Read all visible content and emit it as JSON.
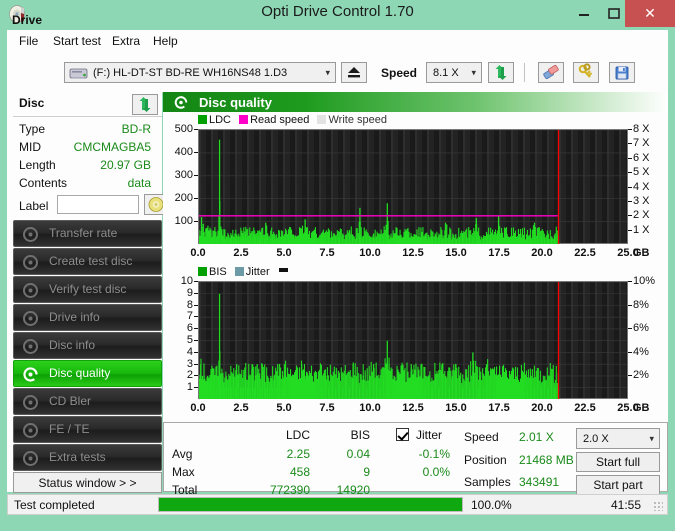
{
  "window": {
    "title": "Opti Drive Control 1.70",
    "icon": "disc-icon",
    "minimize": "–",
    "maximize": "☐",
    "close": "✕"
  },
  "menu": {
    "items": [
      {
        "label": "File"
      },
      {
        "label": "Start test"
      },
      {
        "label": "Extra"
      },
      {
        "label": "Help"
      }
    ]
  },
  "toolbar": {
    "drive_label": "Drive",
    "drive_value": "(F:)  HL-DT-ST BD-RE  WH16NS48 1.D3",
    "eject_icon": "eject-icon",
    "speed_label": "Speed",
    "speed_value": "8.1 X",
    "refresh_icon": "refresh-icon",
    "eraser_icon": "eraser-icon",
    "keys_icon": "keys-icon",
    "save_icon": "save-icon"
  },
  "disc_panel": {
    "header": "Disc",
    "refresh_icon": "refresh-icon",
    "rows": [
      {
        "key": "Type",
        "value": "BD-R"
      },
      {
        "key": "MID",
        "value": "CMCMAGBA5"
      },
      {
        "key": "Length",
        "value": "20.97 GB"
      },
      {
        "key": "Contents",
        "value": "data"
      }
    ],
    "label_key": "Label",
    "label_value": "",
    "label_placeholder": "",
    "label_button_icon": "disc-label-icon"
  },
  "nav": {
    "items": [
      {
        "label": "Transfer rate",
        "icon": "disc-test-icon",
        "selected": false
      },
      {
        "label": "Create test disc",
        "icon": "disc-write-icon",
        "selected": false
      },
      {
        "label": "Verify test disc",
        "icon": "disc-verify-icon",
        "selected": false
      },
      {
        "label": "Drive info",
        "icon": "drive-info-icon",
        "selected": false
      },
      {
        "label": "Disc info",
        "icon": "disc-info-icon",
        "selected": false
      },
      {
        "label": "Disc quality",
        "icon": "disc-quality-icon",
        "selected": true
      },
      {
        "label": "CD Bler",
        "icon": "disc-bler-icon",
        "selected": false
      },
      {
        "label": "FE / TE",
        "icon": "disc-fete-icon",
        "selected": false
      },
      {
        "label": "Extra tests",
        "icon": "disc-extra-icon",
        "selected": false
      }
    ],
    "status_window": "Status window > >"
  },
  "main": {
    "title": "Disc quality",
    "title_icon": "disc-quality-icon"
  },
  "chart_data": [
    {
      "type": "line",
      "name": "ldc-chart",
      "title": "",
      "xlabel": "GB",
      "ylabel": "",
      "xlim": [
        0,
        25
      ],
      "ylim": [
        0,
        500
      ],
      "y2lim": [
        0,
        8
      ],
      "y2label": "X",
      "xticks": [
        "0.0",
        "2.5",
        "5.0",
        "7.5",
        "10.0",
        "12.5",
        "15.0",
        "17.5",
        "20.0",
        "22.5",
        "25.0"
      ],
      "xtickvals": [
        0,
        2.5,
        5,
        7.5,
        10,
        12.5,
        15,
        17.5,
        20,
        22.5,
        25
      ],
      "yticks": [
        "100",
        "200",
        "300",
        "400",
        "500"
      ],
      "ytickvals": [
        100,
        200,
        300,
        400,
        500
      ],
      "y2ticks": [
        "1 X",
        "2 X",
        "3 X",
        "4 X",
        "5 X",
        "6 X",
        "7 X",
        "8 X"
      ],
      "y2tickvals": [
        1,
        2,
        3,
        4,
        5,
        6,
        7,
        8
      ],
      "legend": [
        {
          "label": "LDC",
          "color": "#00a000"
        },
        {
          "label": "Read speed",
          "color": "#ff00c8"
        },
        {
          "label": "Write speed",
          "color": "#e8e8e8"
        }
      ],
      "end_marker_x": 21.0,
      "end_marker_color": "#ff0000",
      "read_speed_line": 2.0,
      "data_end_x": 21.0,
      "series": [
        {
          "name": "LDC",
          "color": "#22dd22",
          "x": [
            0.05,
            0.15,
            0.25,
            0.3,
            0.4,
            0.45,
            0.5,
            0.6,
            0.7,
            0.8,
            0.9,
            1.0,
            1.1,
            1.2,
            1.3,
            1.35,
            1.4,
            1.5,
            1.6,
            1.7,
            1.8,
            1.9,
            2.0,
            2.1,
            2.2,
            2.3,
            2.4,
            2.5,
            2.6,
            2.7,
            2.8,
            2.9,
            3.0,
            3.1,
            3.2,
            3.3,
            3.4,
            3.5,
            3.6,
            3.7,
            3.8,
            3.9,
            4.0,
            4.1,
            4.2,
            4.3,
            4.4,
            4.5,
            4.6,
            4.7,
            4.8,
            4.9,
            5.0,
            5.2,
            5.4,
            5.6,
            5.8,
            6.0,
            6.2,
            6.4,
            6.6,
            6.7,
            6.8,
            7.0,
            7.2,
            7.4,
            7.6,
            7.8,
            8.0,
            8.2,
            8.4,
            8.6,
            8.8,
            9.0,
            9.2,
            9.4,
            9.45,
            9.6,
            9.8,
            10.0,
            10.2,
            10.4,
            10.6,
            10.8,
            11.0,
            11.1,
            11.2,
            11.4,
            11.6,
            11.8,
            12.0,
            12.2,
            12.4,
            12.6,
            12.8,
            13.0,
            13.2,
            13.4,
            13.6,
            13.8,
            14.0,
            14.2,
            14.4,
            14.6,
            14.8,
            15.0,
            15.2,
            15.4,
            15.6,
            15.8,
            16.0,
            16.2,
            16.3,
            16.4,
            16.6,
            16.8,
            17.0,
            17.2,
            17.4,
            17.5,
            17.6,
            17.8,
            18.0,
            18.2,
            18.4,
            18.6,
            18.8,
            19.0,
            19.2,
            19.4,
            19.6,
            19.8,
            20.0,
            20.2,
            20.4,
            20.6,
            20.8,
            21.0
          ],
          "y": [
            35,
            120,
            90,
            55,
            70,
            45,
            60,
            40,
            50,
            35,
            45,
            30,
            40,
            458,
            60,
            45,
            38,
            55,
            35,
            45,
            30,
            40,
            35,
            30,
            45,
            38,
            30,
            60,
            35,
            45,
            30,
            38,
            42,
            30,
            45,
            35,
            40,
            30,
            55,
            40,
            30,
            95,
            45,
            38,
            30,
            45,
            35,
            40,
            30,
            50,
            35,
            42,
            30,
            45,
            55,
            38,
            30,
            42,
            110,
            45,
            35,
            60,
            40,
            32,
            45,
            38,
            55,
            35,
            42,
            30,
            48,
            35,
            60,
            40,
            32,
            160,
            45,
            38,
            42,
            35,
            48,
            30,
            45,
            38,
            180,
            42,
            35,
            48,
            30,
            42,
            38,
            55,
            32,
            45,
            35,
            50,
            38,
            42,
            30,
            48,
            35,
            42,
            95,
            38,
            30,
            45,
            35,
            50,
            38,
            42,
            30,
            115,
            45,
            38,
            30,
            55,
            42,
            35,
            48,
            125,
            38,
            30,
            45,
            35,
            42,
            30,
            48,
            38,
            42,
            30,
            95,
            45,
            38,
            30,
            42,
            35,
            48,
            38,
            30,
            45
          ]
        }
      ]
    },
    {
      "type": "line",
      "name": "bis-chart",
      "title": "",
      "xlabel": "GB",
      "ylabel": "",
      "xlim": [
        0,
        25
      ],
      "ylim": [
        0,
        10
      ],
      "y2lim": [
        0,
        10
      ],
      "y2label": "%",
      "xticks": [
        "0.0",
        "2.5",
        "5.0",
        "7.5",
        "10.0",
        "12.5",
        "15.0",
        "17.5",
        "20.0",
        "22.5",
        "25.0"
      ],
      "xtickvals": [
        0,
        2.5,
        5,
        7.5,
        10,
        12.5,
        15,
        17.5,
        20,
        22.5,
        25
      ],
      "yticks": [
        "1",
        "2",
        "3",
        "4",
        "5",
        "6",
        "7",
        "8",
        "9",
        "10"
      ],
      "ytickvals": [
        1,
        2,
        3,
        4,
        5,
        6,
        7,
        8,
        9,
        10
      ],
      "y2ticks": [
        "2%",
        "4%",
        "6%",
        "8%",
        "10%"
      ],
      "y2tickvals": [
        2,
        4,
        6,
        8,
        10
      ],
      "legend": [
        {
          "label": "BIS",
          "color": "#00a000"
        },
        {
          "label": "Jitter",
          "color": "#6d9ba5"
        }
      ],
      "end_marker_x": 21.0,
      "end_marker_color": "#ff0000",
      "data_end_x": 21.0,
      "series": [
        {
          "name": "BIS",
          "color": "#22dd22",
          "x": [
            0.1,
            0.2,
            0.3,
            0.4,
            0.5,
            0.6,
            0.7,
            0.8,
            0.9,
            1.0,
            1.1,
            1.2,
            1.25,
            1.3,
            1.4,
            1.5,
            1.6,
            1.7,
            1.8,
            1.9,
            2.0,
            2.1,
            2.2,
            2.3,
            2.4,
            2.5,
            2.6,
            2.7,
            2.8,
            2.9,
            3.0,
            3.1,
            3.2,
            3.3,
            3.4,
            3.5,
            3.6,
            3.7,
            3.8,
            3.9,
            4.0,
            4.1,
            4.2,
            4.3,
            4.4,
            4.5,
            4.6,
            4.7,
            4.8,
            4.9,
            5.0,
            5.2,
            5.4,
            5.6,
            5.8,
            6.0,
            6.2,
            6.4,
            6.6,
            6.8,
            7.0,
            7.2,
            7.4,
            7.6,
            7.8,
            8.0,
            8.2,
            8.4,
            8.6,
            8.8,
            9.0,
            9.2,
            9.4,
            9.6,
            9.8,
            10.0,
            10.2,
            10.4,
            10.6,
            10.8,
            11.0,
            11.1,
            11.2,
            11.3,
            11.4,
            11.6,
            11.8,
            12.0,
            12.2,
            12.4,
            12.6,
            12.8,
            13.0,
            13.2,
            13.4,
            13.6,
            13.8,
            14.0,
            14.2,
            14.4,
            14.6,
            14.8,
            15.0,
            15.2,
            15.4,
            15.6,
            15.8,
            16.0,
            16.2,
            16.3,
            16.4,
            16.6,
            16.8,
            17.0,
            17.2,
            17.4,
            17.6,
            17.8,
            18.0,
            18.2,
            18.4,
            18.6,
            18.8,
            19.0,
            19.2,
            19.4,
            19.6,
            19.8,
            20.0,
            20.2,
            20.4,
            20.6,
            20.8,
            21.0
          ],
          "y": [
            3,
            2,
            2,
            1,
            2,
            1,
            2,
            1,
            2,
            1,
            2,
            9,
            2,
            1,
            2,
            1,
            2,
            1,
            2,
            1,
            2,
            1,
            3,
            2,
            1,
            1,
            1,
            2,
            1,
            2,
            1,
            3,
            1,
            2,
            3,
            2,
            1,
            3,
            2,
            1,
            2,
            1,
            2,
            1,
            2,
            1,
            3,
            2,
            1,
            2,
            3,
            2,
            1,
            2,
            1,
            3,
            2,
            1,
            2,
            1,
            2,
            1,
            2,
            1,
            2,
            1,
            2,
            1,
            2,
            1,
            3,
            2,
            1,
            2,
            1,
            2,
            3,
            2,
            1,
            2,
            5,
            3,
            2,
            1,
            2,
            1,
            2,
            1,
            2,
            3,
            2,
            1,
            2,
            1,
            2,
            1,
            2,
            1,
            3,
            2,
            1,
            2,
            3,
            2,
            1,
            2,
            1,
            4,
            2,
            1,
            2,
            1,
            3,
            2,
            1,
            2,
            1,
            2,
            1,
            2,
            1,
            2,
            1,
            2,
            1,
            2,
            1,
            2,
            1,
            2,
            1,
            2,
            1,
            1
          ]
        }
      ]
    }
  ],
  "stats": {
    "col_ldc": "LDC",
    "col_bis": "BIS",
    "jitter_label": "Jitter",
    "jitter_checked": true,
    "rows": [
      {
        "label": "Avg",
        "ldc": "2.25",
        "bis": "0.04",
        "jitter": "-0.1%"
      },
      {
        "label": "Max",
        "ldc": "458",
        "bis": "9",
        "jitter": "0.0%"
      },
      {
        "label": "Total",
        "ldc": "772390",
        "bis": "14920",
        "jitter": ""
      }
    ],
    "speed_label": "Speed",
    "speed_value": "2.01 X",
    "position_label": "Position",
    "position_value": "21468 MB",
    "samples_label": "Samples",
    "samples_value": "343491",
    "speed_select": "2.0 X",
    "start_full": "Start full",
    "start_part": "Start part"
  },
  "statusbar": {
    "text": "Test completed",
    "progress_percent": 100.0,
    "progress_text": "100.0%",
    "elapsed": "41:55"
  }
}
